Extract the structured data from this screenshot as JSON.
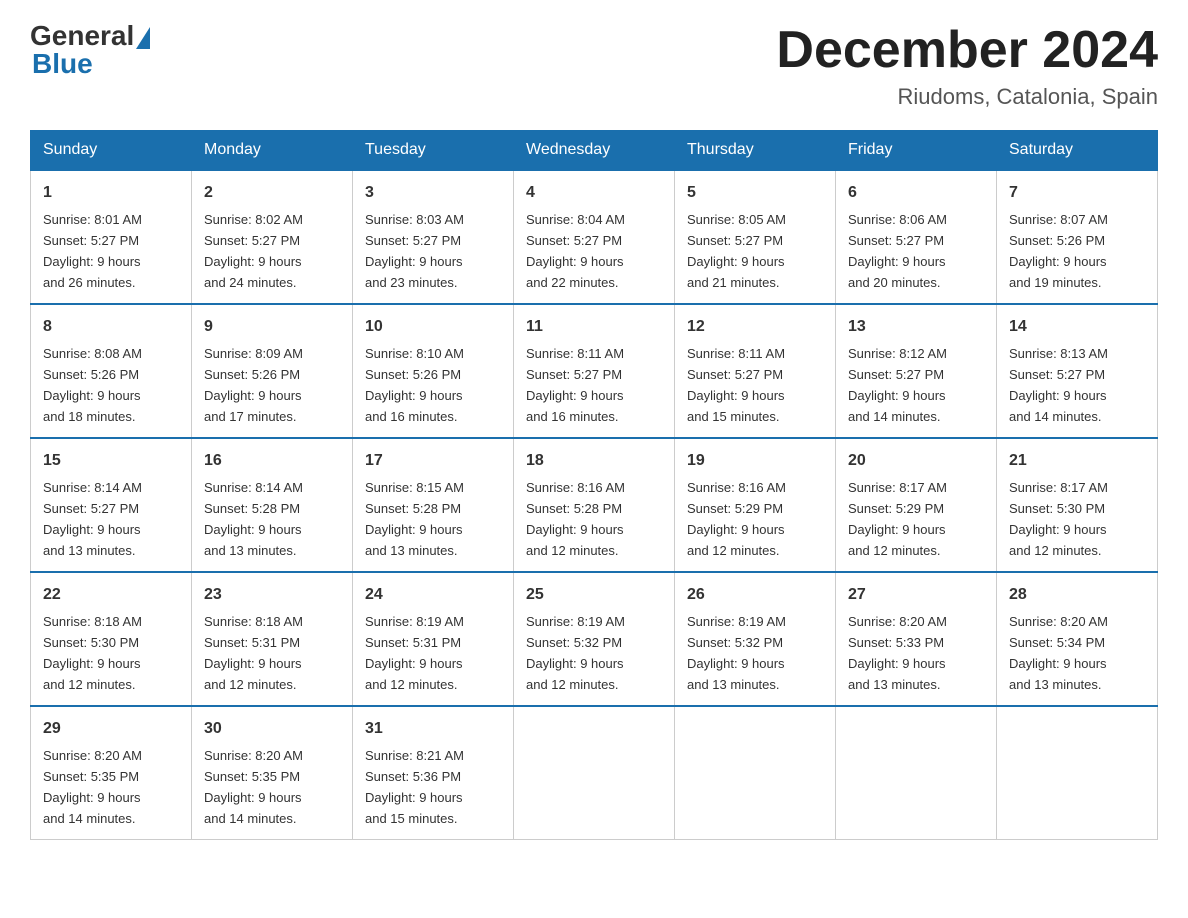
{
  "logo": {
    "general": "General",
    "blue": "Blue"
  },
  "header": {
    "month_year": "December 2024",
    "location": "Riudoms, Catalonia, Spain"
  },
  "weekdays": [
    "Sunday",
    "Monday",
    "Tuesday",
    "Wednesday",
    "Thursday",
    "Friday",
    "Saturday"
  ],
  "weeks": [
    [
      {
        "day": "1",
        "sunrise": "8:01 AM",
        "sunset": "5:27 PM",
        "daylight": "9 hours and 26 minutes."
      },
      {
        "day": "2",
        "sunrise": "8:02 AM",
        "sunset": "5:27 PM",
        "daylight": "9 hours and 24 minutes."
      },
      {
        "day": "3",
        "sunrise": "8:03 AM",
        "sunset": "5:27 PM",
        "daylight": "9 hours and 23 minutes."
      },
      {
        "day": "4",
        "sunrise": "8:04 AM",
        "sunset": "5:27 PM",
        "daylight": "9 hours and 22 minutes."
      },
      {
        "day": "5",
        "sunrise": "8:05 AM",
        "sunset": "5:27 PM",
        "daylight": "9 hours and 21 minutes."
      },
      {
        "day": "6",
        "sunrise": "8:06 AM",
        "sunset": "5:27 PM",
        "daylight": "9 hours and 20 minutes."
      },
      {
        "day": "7",
        "sunrise": "8:07 AM",
        "sunset": "5:26 PM",
        "daylight": "9 hours and 19 minutes."
      }
    ],
    [
      {
        "day": "8",
        "sunrise": "8:08 AM",
        "sunset": "5:26 PM",
        "daylight": "9 hours and 18 minutes."
      },
      {
        "day": "9",
        "sunrise": "8:09 AM",
        "sunset": "5:26 PM",
        "daylight": "9 hours and 17 minutes."
      },
      {
        "day": "10",
        "sunrise": "8:10 AM",
        "sunset": "5:26 PM",
        "daylight": "9 hours and 16 minutes."
      },
      {
        "day": "11",
        "sunrise": "8:11 AM",
        "sunset": "5:27 PM",
        "daylight": "9 hours and 16 minutes."
      },
      {
        "day": "12",
        "sunrise": "8:11 AM",
        "sunset": "5:27 PM",
        "daylight": "9 hours and 15 minutes."
      },
      {
        "day": "13",
        "sunrise": "8:12 AM",
        "sunset": "5:27 PM",
        "daylight": "9 hours and 14 minutes."
      },
      {
        "day": "14",
        "sunrise": "8:13 AM",
        "sunset": "5:27 PM",
        "daylight": "9 hours and 14 minutes."
      }
    ],
    [
      {
        "day": "15",
        "sunrise": "8:14 AM",
        "sunset": "5:27 PM",
        "daylight": "9 hours and 13 minutes."
      },
      {
        "day": "16",
        "sunrise": "8:14 AM",
        "sunset": "5:28 PM",
        "daylight": "9 hours and 13 minutes."
      },
      {
        "day": "17",
        "sunrise": "8:15 AM",
        "sunset": "5:28 PM",
        "daylight": "9 hours and 13 minutes."
      },
      {
        "day": "18",
        "sunrise": "8:16 AM",
        "sunset": "5:28 PM",
        "daylight": "9 hours and 12 minutes."
      },
      {
        "day": "19",
        "sunrise": "8:16 AM",
        "sunset": "5:29 PM",
        "daylight": "9 hours and 12 minutes."
      },
      {
        "day": "20",
        "sunrise": "8:17 AM",
        "sunset": "5:29 PM",
        "daylight": "9 hours and 12 minutes."
      },
      {
        "day": "21",
        "sunrise": "8:17 AM",
        "sunset": "5:30 PM",
        "daylight": "9 hours and 12 minutes."
      }
    ],
    [
      {
        "day": "22",
        "sunrise": "8:18 AM",
        "sunset": "5:30 PM",
        "daylight": "9 hours and 12 minutes."
      },
      {
        "day": "23",
        "sunrise": "8:18 AM",
        "sunset": "5:31 PM",
        "daylight": "9 hours and 12 minutes."
      },
      {
        "day": "24",
        "sunrise": "8:19 AM",
        "sunset": "5:31 PM",
        "daylight": "9 hours and 12 minutes."
      },
      {
        "day": "25",
        "sunrise": "8:19 AM",
        "sunset": "5:32 PM",
        "daylight": "9 hours and 12 minutes."
      },
      {
        "day": "26",
        "sunrise": "8:19 AM",
        "sunset": "5:32 PM",
        "daylight": "9 hours and 13 minutes."
      },
      {
        "day": "27",
        "sunrise": "8:20 AM",
        "sunset": "5:33 PM",
        "daylight": "9 hours and 13 minutes."
      },
      {
        "day": "28",
        "sunrise": "8:20 AM",
        "sunset": "5:34 PM",
        "daylight": "9 hours and 13 minutes."
      }
    ],
    [
      {
        "day": "29",
        "sunrise": "8:20 AM",
        "sunset": "5:35 PM",
        "daylight": "9 hours and 14 minutes."
      },
      {
        "day": "30",
        "sunrise": "8:20 AM",
        "sunset": "5:35 PM",
        "daylight": "9 hours and 14 minutes."
      },
      {
        "day": "31",
        "sunrise": "8:21 AM",
        "sunset": "5:36 PM",
        "daylight": "9 hours and 15 minutes."
      },
      null,
      null,
      null,
      null
    ]
  ],
  "labels": {
    "sunrise": "Sunrise:",
    "sunset": "Sunset:",
    "daylight": "Daylight:"
  }
}
